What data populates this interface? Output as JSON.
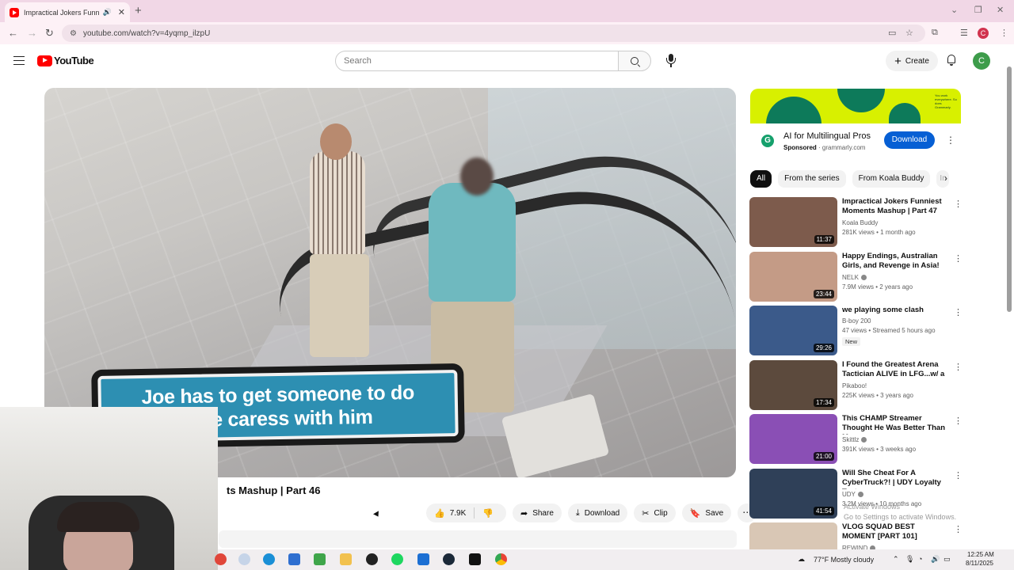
{
  "browser": {
    "tab_title": "Impractical Jokers Funniest",
    "url": "youtube.com/watch?v=4yqmp_ilzpU",
    "profile_initial": "C"
  },
  "youtube": {
    "brand": "YouTube",
    "search_placeholder": "Search",
    "create_label": "Create",
    "avatar_initial": "C"
  },
  "player": {
    "caption_line1": "Joe has to get someone to do",
    "caption_line2": "face caress with him"
  },
  "video": {
    "title_visible": "ts Mashup | Part 46",
    "like_count": "7.9K",
    "share_label": "Share",
    "download_label": "Download",
    "clip_label": "Clip",
    "save_label": "Save"
  },
  "ad": {
    "title": "AI for Multilingual Pros",
    "sponsored": "Sponsored",
    "domain": "grammarly.com",
    "download_label": "Download",
    "banner_small_text": "You work everywhere. So does Grammarly.",
    "accent_color": "#d8f000"
  },
  "chips": [
    "All",
    "From the series",
    "From Koala Buddy",
    "In"
  ],
  "recommendations": [
    {
      "title": "Impractical Jokers Funniest Moments Mashup | Part 47",
      "channel": "Koala Buddy",
      "verified": false,
      "meta": "281K views • 1 month ago",
      "duration": "11:37",
      "badge": "",
      "thumb_color": "#7d5b4c"
    },
    {
      "title": "Happy Endings, Australian Girls, and Revenge in Asia!",
      "channel": "NELK",
      "verified": true,
      "meta": "7.9M views • 2 years ago",
      "duration": "23:44",
      "badge": "",
      "thumb_color": "#c49b86"
    },
    {
      "title": "we playing some clash",
      "channel": "B-boy 200",
      "verified": false,
      "meta": "47 views • Streamed 5 hours ago",
      "duration": "29:26",
      "badge": "New",
      "thumb_color": "#3b5a8a"
    },
    {
      "title": "I Found the Greatest Arena Tactician ALIVE in LFG...w/ a ...",
      "channel": "Pikaboo!",
      "verified": false,
      "meta": "225K views • 3 years ago",
      "duration": "17:34",
      "badge": "",
      "thumb_color": "#5c4a3d"
    },
    {
      "title": "This CHAMP Streamer Thought He Was Better Than Me...",
      "channel": "Skittlz",
      "verified": true,
      "meta": "391K views • 3 weeks ago",
      "duration": "21:00",
      "badge": "",
      "thumb_color": "#8a4fb5"
    },
    {
      "title": "Will She Cheat For A CyberTruck?! | UDY Loyalty Test",
      "channel": "UDY",
      "verified": true,
      "meta": "3.2M views • 10 months ago",
      "duration": "41:54",
      "badge": "",
      "thumb_color": "#2f4058"
    },
    {
      "title": "VLOG SQUAD BEST MOMENT [PART 101]",
      "channel": "REWIND",
      "verified": true,
      "meta": "",
      "duration": "",
      "badge": "",
      "thumb_color": "#d9c7b5"
    }
  ],
  "taskbar": {
    "weather": "77°F  Mostly cloudy",
    "time": "12:25 AM",
    "date": "8/11/2025",
    "activate_line1": "Activate Windows",
    "activate_line2": "Go to Settings to activate Windows."
  }
}
